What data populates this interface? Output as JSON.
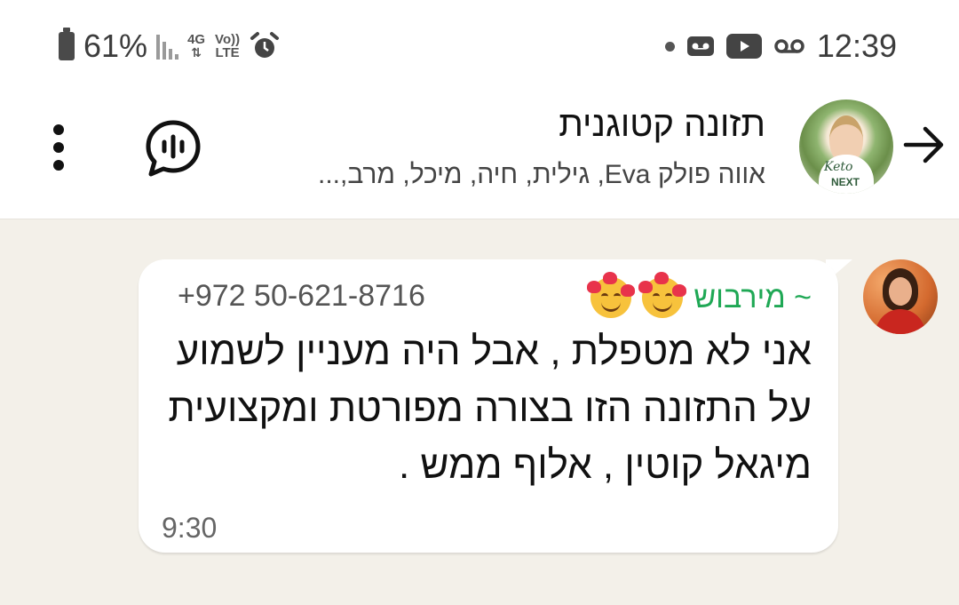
{
  "status_bar": {
    "battery": "61%",
    "network": "4G",
    "volte": "Vo)) LTE",
    "time": "12:39",
    "icons": [
      "battery-icon",
      "signal-icon",
      "4g-icon",
      "volte-icon",
      "alarm-icon",
      "dot-icon",
      "voicemail-icon",
      "youtube-icon",
      "voicemail-icon"
    ]
  },
  "header": {
    "title": "תזונה קטוגנית",
    "members": "אווה פולק Eva, גילית, חיה, מיכל, מרב,...",
    "avatar_text": {
      "line1": "Keto",
      "line2": "NEXT"
    }
  },
  "message": {
    "sender_name": "~ מירבוש",
    "sender_phone": "+972 50-621-8716",
    "text": "אני לא מטפלת , אבל היה מעניין לשמוע על התזונה הזו בצורה מפורטת ומקצועית מיגאל קוטין , אלוף ממש .",
    "time": "9:30"
  },
  "colors": {
    "sender_name": "#1fa855",
    "chat_background": "#f3f0e9",
    "bubble": "#ffffff"
  }
}
